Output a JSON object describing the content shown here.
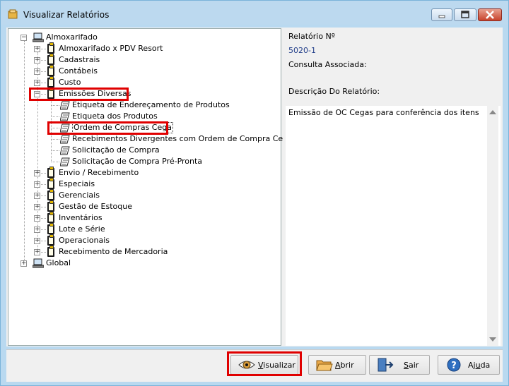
{
  "window": {
    "title": "Visualizar Relatórios"
  },
  "tree": {
    "root1": "Almoxarifado",
    "root2": "Global",
    "folders": [
      "Almoxarifado x PDV Resort",
      "Cadastrais",
      "Contábeis",
      "Custo",
      "Emissões Diversas",
      "Envio / Recebimento",
      "Especiais",
      "Gerenciais",
      "Gestão de Estoque",
      "Inventários",
      "Lote e Série",
      "Operacionais",
      "Recebimento de Mercadoria"
    ],
    "reports": [
      "Etiqueta de Endereçamento de Produtos",
      "Etiqueta dos Produtos",
      "Ordem de Compras Cega",
      "Recebimentos Divergentes com Ordem de Compra Cega",
      "Solicitação de Compra",
      "Solicitação de Compra Pré-Pronta"
    ]
  },
  "info": {
    "report_no_label": "Relatório Nº",
    "report_no_value": "5020-1",
    "query_label": "Consulta Associada:",
    "desc_label": "Descrição Do Relatório:",
    "desc_text": "Emissão de OC Cegas para conferência dos itens"
  },
  "buttons": {
    "view": {
      "hot": "V",
      "rest": "isualizar"
    },
    "open": {
      "hot": "A",
      "rest": "brir"
    },
    "exit": {
      "hot": "S",
      "rest": "air"
    },
    "help": {
      "pre": "Aj",
      "hot": "u",
      "rest": "da"
    }
  },
  "colors": {
    "highlight": "#e00000",
    "accent_text": "#1f3c88"
  }
}
